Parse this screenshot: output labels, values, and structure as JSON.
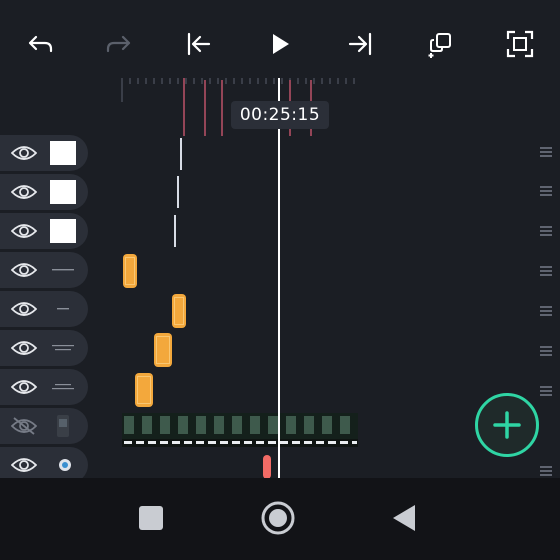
{
  "toolbar": {
    "undo": "undo-icon",
    "redo": "redo-icon",
    "go_start": "skip-to-start-icon",
    "play": "play-icon",
    "go_end": "skip-to-end-icon",
    "duplicate": "duplicate-layer-icon",
    "fullscreen": "fullscreen-icon"
  },
  "timeline": {
    "current_time": "00:25:15"
  },
  "layers": [
    {
      "visible": true,
      "thumb": "white"
    },
    {
      "visible": true,
      "thumb": "white"
    },
    {
      "visible": true,
      "thumb": "white"
    },
    {
      "visible": true,
      "thumb": "text"
    },
    {
      "visible": true,
      "thumb": "text"
    },
    {
      "visible": true,
      "thumb": "text"
    },
    {
      "visible": true,
      "thumb": "text"
    },
    {
      "visible": false,
      "thumb": "video"
    },
    {
      "visible": true,
      "thumb": "image"
    }
  ],
  "fab": {
    "icon": "add-icon"
  },
  "nav": {
    "recents": "square-icon",
    "home": "circle-icon",
    "back": "triangle-back-icon"
  },
  "colors": {
    "accent": "#2fd5a4",
    "clip": "#f3a83c",
    "marker": "#f26b66",
    "background": "#1b1e24"
  }
}
